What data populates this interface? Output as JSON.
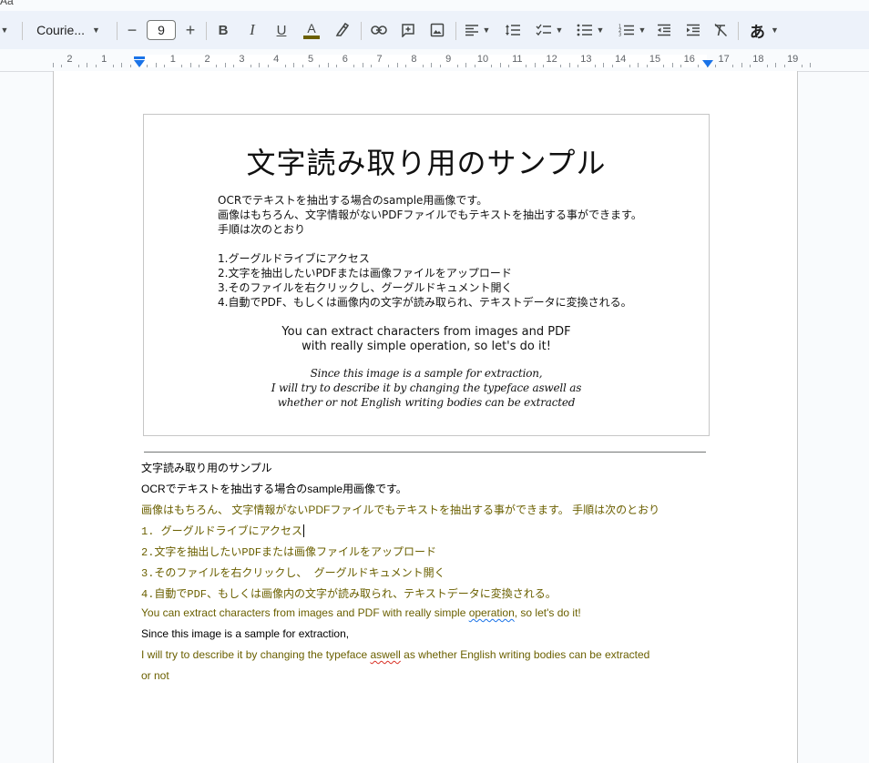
{
  "window": {
    "top_fragment": "Aa"
  },
  "toolbar": {
    "font_name": "Courie...",
    "font_size": "9",
    "minus": "−",
    "plus": "+",
    "bold": "B",
    "italic": "I",
    "underline": "U",
    "text_color_letter": "A",
    "text_color": "#6b6000",
    "input_tool": "あ"
  },
  "ruler": {
    "numbers": [
      "2",
      "1",
      "1",
      "2",
      "3",
      "4",
      "5",
      "6",
      "7",
      "8",
      "9",
      "10",
      "11",
      "12",
      "13",
      "14",
      "15",
      "16",
      "17",
      "18",
      "19"
    ]
  },
  "image": {
    "title": "文字読み取り用のサンプル",
    "jp_lines": [
      "OCRでテキストを抽出する場合のsample用画像です。",
      "画像はもちろん、文字情報がないPDFファイルでもテキストを抽出する事ができます。",
      "手順は次のとおり",
      "1.グーグルドライブにアクセス",
      "2.文字を抽出したいPDFまたは画像ファイルをアップロード",
      "3.そのファイルを右クリックし、グーグルドキュメント開く",
      "4.自動でPDF、もしくは画像内の文字が読み取られ、テキストデータに変換される。"
    ],
    "en_lines": [
      "You can extract characters from images and PDF",
      "with really simple operation, so let's do it!"
    ],
    "script_lines": [
      "Since this image is a sample for extraction,",
      "I will try to describe it by changing the typeface aswell as",
      "whether or not English writing bodies can be extracted"
    ]
  },
  "doc": {
    "line1": "文字読み取り用のサンプル",
    "line2": "OCRでテキストを抽出する場合のsample用画像です。",
    "line3": "画像はもちろん、 文字情報がないPDFファイルでもテキストを抽出する事ができます。 手順は次のとおり",
    "line4": "1. グーグルドライブにアクセス",
    "line5": "2.文字を抽出したいPDFまたは画像ファイルをアップロード",
    "line6": "3.そのファイルを右クリックし、 グーグルドキュメント開く",
    "line7": "4.自動でPDF、もしくは画像内の文字が読み取られ、テキストデータに変換される。",
    "line8_a": "You can extract characters from images and PDF with really simple ",
    "line8_b": "operation",
    "line8_c": ", so let's do it!",
    "line9": "Since this image is a sample for extraction,",
    "line10_a": "I will try to describe it by changing the typeface ",
    "line10_b": "aswell",
    "line10_c": " as whether English writing bodies can be extracted",
    "line11": "or not"
  }
}
